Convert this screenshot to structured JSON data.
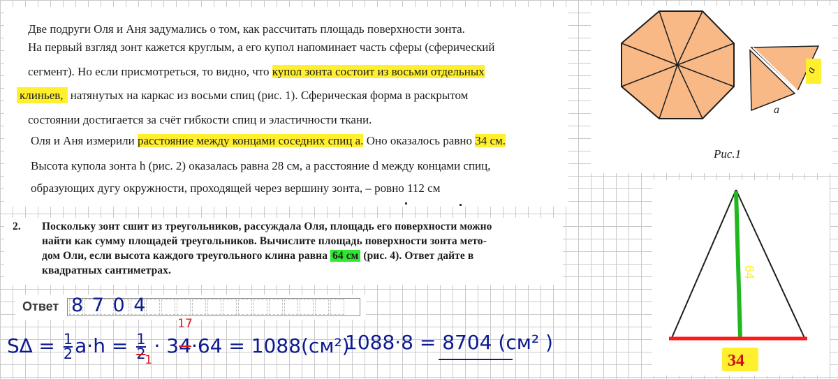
{
  "intro": {
    "line1": "Две подруги Оля и Аня задумались о том, как рассчитать площадь поверхности зонта.",
    "line2": "На первый взгляд зонт кажется круглым, а его купол напоминает часть сферы (сферический",
    "line3_a": "сегмент). Но если присмотреться, то видно, что ",
    "line3_hl": "купол зонта состоит из восьми отдельных",
    "line4_hl": "клиньев,",
    "line4_b": " натянутых на каркас из восьми спиц (рис. 1). Сферическая форма в раскрытом",
    "line5": "состоянии достигается за счёт гибкости спиц и эластичности ткани.",
    "line6_a": "Оля и Аня измерили ",
    "line6_hl": "расстояние между концами соседних спиц a.",
    "line6_b": " Оно оказалось равно ",
    "line6_val": "34 см.",
    "line7": "Высота купола зонта h (рис. 2) оказалась равна 28 см, а расстояние d между концами спиц,",
    "line8": "образующих дугу окружности, проходящей через вершину зонта, – ровно 112 см"
  },
  "task": {
    "number": "2.",
    "line1": "Поскольку зонт сшит из треугольников, рассуждала Оля, площадь его поверхности можно",
    "line2": "найти как сумму площадей треугольников. Вычислите площадь поверхности зонта мето-",
    "line3_a": "дом Оли, если высота каждого треугольного клина равна ",
    "line3_hl": "64 см",
    "line3_b": " (рис. 4). Ответ дайте в",
    "line4": "квадратных сантиметрах."
  },
  "answer": {
    "label": "Ответ",
    "value": "8 7 0 4"
  },
  "solution": {
    "lhs": "S∆ = ",
    "half1_num": "1",
    "half1_den": "2",
    "mid1": "a·h = ",
    "half2_num": "1",
    "half2_den": "2",
    "den_corr": "1",
    "dot": " · ",
    "base_a": "3",
    "base_b": "4",
    "base_corr": "17",
    "rest": "·64 = 1088(см²)",
    "total": "1088·8 = 8704 (см² )"
  },
  "figure1": {
    "caption": "Рис.1",
    "side_label_a1": "a",
    "side_label_a2": "a",
    "colors": {
      "fill": "#f8b987",
      "stroke": "#1e1e1e",
      "highlight": "#ffef2e"
    }
  },
  "figure4": {
    "height_label": "64",
    "base_label": "34",
    "colors": {
      "height": "#1fb81f",
      "base": "#ff1a1a",
      "label_bg": "#ffef2e"
    }
  }
}
